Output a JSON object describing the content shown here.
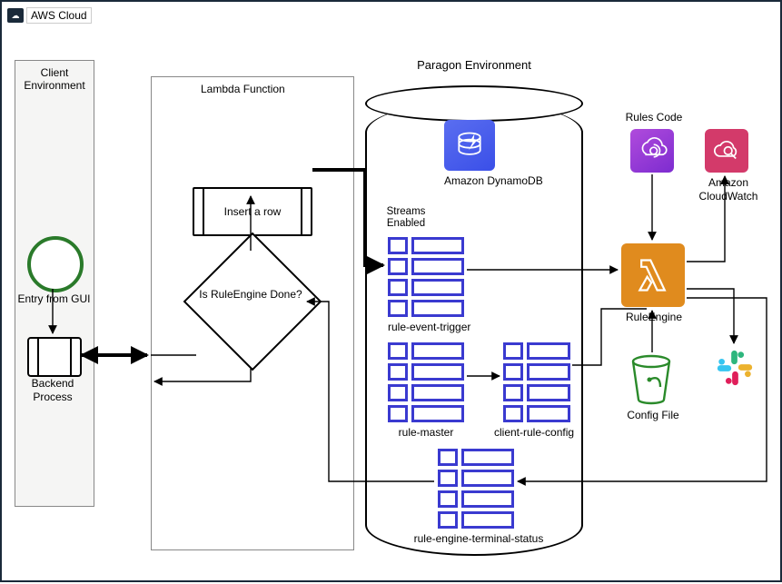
{
  "cloud_label": "AWS Cloud",
  "client_env": {
    "title": "Client\nEnvironment",
    "entry_label": "Entry from GUI",
    "backend_label": "Backend\nProcess"
  },
  "lambda_box": {
    "title": "Lambda Function",
    "insert_row": "Insert a row",
    "decision": "Is RuleEngine\nDone?"
  },
  "paragon": {
    "title": "Paragon Environment",
    "dynamo_label": "Amazon\nDynamoDB",
    "streams_label": "Streams\nEnabled",
    "tables": {
      "trigger": "rule-event-trigger",
      "master": "rule-master",
      "client_cfg": "client-rule-config",
      "terminal": "rule-engine-terminal-status"
    },
    "rule_engine_label": "RuleEngine",
    "rules_code_label": "Rules Code",
    "cloudwatch_label": "Amazon\nCloudWatch",
    "config_file_label": "Config File"
  }
}
